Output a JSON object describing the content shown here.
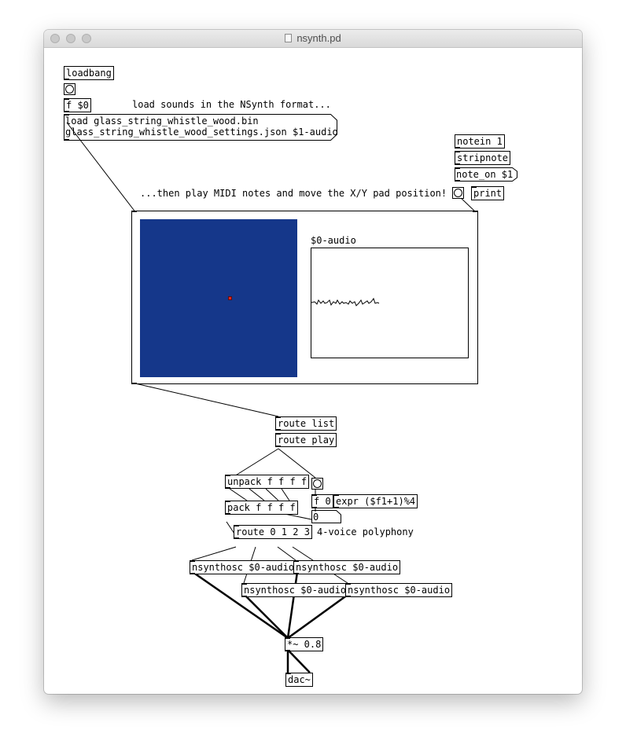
{
  "window": {
    "title": "nsynth.pd"
  },
  "objects": {
    "loadbang": "loadbang",
    "f_dollar0": "f $0",
    "notein": "notein 1",
    "stripnote": "stripnote",
    "print": "print",
    "route_list": "route list",
    "route_play": "route play",
    "unpack": "unpack f f f f",
    "pack": "pack f f f f",
    "f_0": "f 0",
    "expr": "expr ($f1+1)%4",
    "route_voices": "route 0 1 2 3",
    "nsynthosc_1": "nsynthosc $0-audio",
    "nsynthosc_2": "nsynthosc $0-audio",
    "nsynthosc_3": "nsynthosc $0-audio",
    "nsynthosc_4": "nsynthosc $0-audio",
    "mult": "*~ 0.8",
    "dac": "dac~"
  },
  "messages": {
    "load_line1": "load glass_string_whistle_wood.bin",
    "load_line2": "glass_string_whistle_wood_settings.json $1-audio",
    "note_on": "note_on $1",
    "counter_value": "0"
  },
  "comments": {
    "load_sounds": "load sounds in the NSynth format...",
    "play_midi": "...then play MIDI notes and move the X/Y pad position!",
    "polyphony": "4-voice polyphony"
  },
  "gui": {
    "array_name": "$0-audio",
    "xy_pad_color": "#15378a",
    "xy_marker_color": "#e8231b"
  }
}
